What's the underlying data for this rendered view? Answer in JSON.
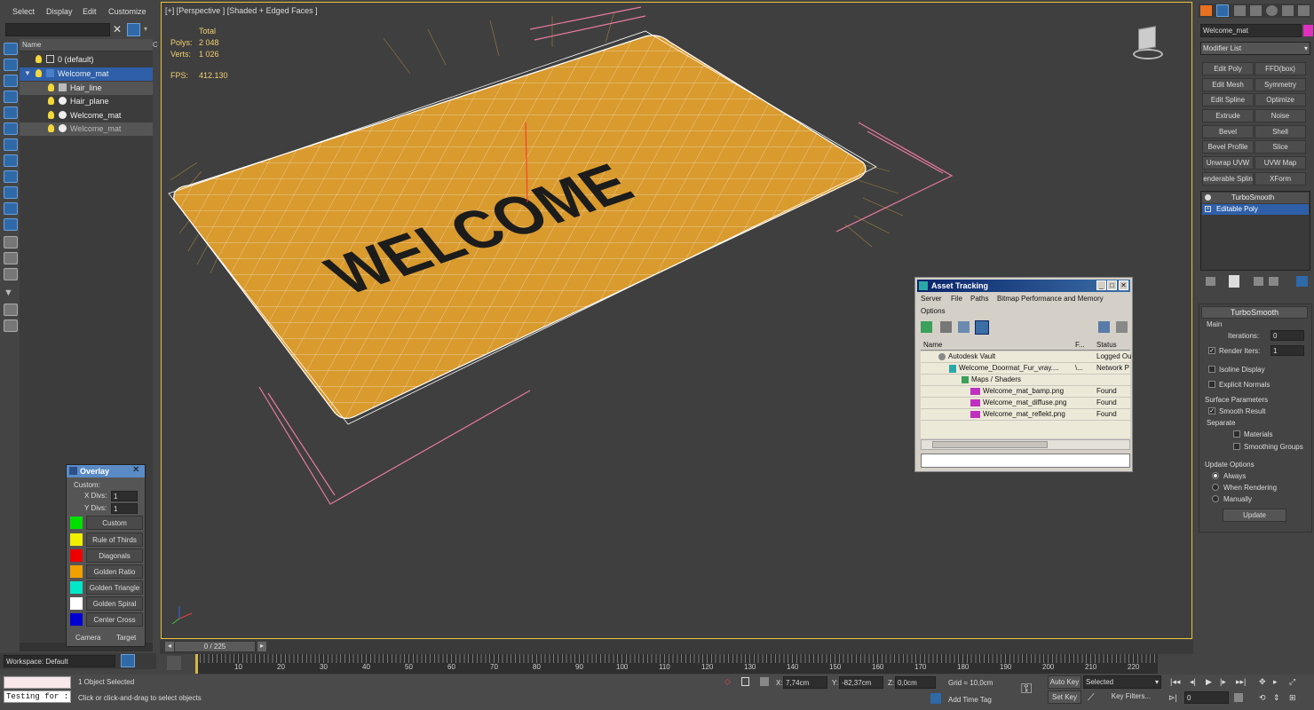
{
  "menu": [
    "Select",
    "Display",
    "Edit",
    "Customize"
  ],
  "explorer": {
    "column_name": "Name",
    "rows": [
      {
        "label": "0 (default)"
      },
      {
        "label": "Welcome_mat"
      },
      {
        "label": "Hair_line"
      },
      {
        "label": "Hair_plane"
      },
      {
        "label": "Welcome_mat"
      },
      {
        "label": "Welcome_mat"
      }
    ],
    "workspace": "Workspace: Default"
  },
  "viewport": {
    "label": "[+] [Perspective ] [Shaded + Edged Faces ]",
    "stats": {
      "total_label": "Total",
      "polys_label": "Polys:",
      "polys_value": "2 048",
      "verts_label": "Verts:",
      "verts_value": "1 026",
      "fps_label": "FPS:",
      "fps_value": "412.130"
    },
    "mat_text": "WELCOME"
  },
  "overlay": {
    "title": "Overlay",
    "custom_label": "Custom:",
    "xdivs_label": "X Divs:",
    "xdivs_value": "1",
    "ydivs_label": "Y Divs:",
    "ydivs_value": "1",
    "items": [
      {
        "label": "Custom",
        "color": "#00e000"
      },
      {
        "label": "Rule of Thirds",
        "color": "#f0f000"
      },
      {
        "label": "Diagonals",
        "color": "#ee0000"
      },
      {
        "label": "Golden Ratio",
        "color": "#f0a000"
      },
      {
        "label": "Golden Triangle",
        "color": "#00e8c8"
      },
      {
        "label": "Golden Spiral",
        "color": "#ffffff"
      },
      {
        "label": "Center Cross",
        "color": "#0000d0"
      }
    ],
    "camera": "Camera",
    "target": "Target"
  },
  "command_panel": {
    "object_name": "Welcome_mat",
    "modifier_list": "Modifier List",
    "modifiers": [
      "Edit Poly",
      "FFD(box)",
      "Edit Mesh",
      "Symmetry",
      "Edit Spline",
      "Optimize",
      "Extrude",
      "Noise",
      "Bevel",
      "Shell",
      "Bevel Profile",
      "Slice",
      "Unwrap UVW",
      "UVW Map",
      "enderable Splin",
      "XForm"
    ],
    "stack": [
      "TurboSmooth",
      "Editable Poly"
    ],
    "turbosmooth": {
      "header": "TurboSmooth",
      "main": "Main",
      "iterations_label": "Iterations:",
      "iterations_value": "0",
      "render_iters_label": "Render Iters:",
      "render_iters_value": "1",
      "isoline": "Isoline Display",
      "explicit_normals": "Explicit Normals",
      "surface_params": "Surface Parameters",
      "smooth_result": "Smooth Result",
      "separate": "Separate",
      "materials": "Materials",
      "smoothing_groups": "Smoothing Groups",
      "update_options": "Update Options",
      "always": "Always",
      "when_rendering": "When Rendering",
      "manually": "Manually",
      "update": "Update"
    }
  },
  "asset_tracking": {
    "title": "Asset Tracking",
    "menu": [
      "Server",
      "File",
      "Paths",
      "Bitmap Performance and Memory"
    ],
    "menu2": "Options",
    "col_name": "Name",
    "col_f": "F...",
    "col_status": "Status",
    "rows": [
      {
        "name": "Autodesk Vault",
        "f": "",
        "status": "Logged Ou"
      },
      {
        "name": "Welcome_Doormat_Fur_vray....",
        "f": "\\...",
        "status": "Network P"
      },
      {
        "name": "Maps / Shaders",
        "f": "",
        "status": ""
      },
      {
        "name": "Welcome_mat_bamp.png",
        "f": "",
        "status": "Found"
      },
      {
        "name": "Welcome_mat_diffuse.png",
        "f": "",
        "status": "Found"
      },
      {
        "name": "Welcome_mat_reflekt.png",
        "f": "",
        "status": "Found"
      }
    ]
  },
  "timeline": {
    "frame": "0 / 225",
    "ticks": [
      "10",
      "20",
      "30",
      "40",
      "50",
      "60",
      "70",
      "80",
      "90",
      "100",
      "110",
      "120",
      "130",
      "140",
      "150",
      "160",
      "170",
      "180",
      "190",
      "200",
      "210",
      "220"
    ]
  },
  "status": {
    "script": "Testing for :",
    "selected": "1 Object Selected",
    "prompt": "Click or click-and-drag to select objects",
    "x_label": "X:",
    "x_value": "7,74cm",
    "y_label": "Y:",
    "y_value": "-82,37cm",
    "z_label": "Z:",
    "z_value": "0,0cm",
    "grid": "Grid = 10,0cm",
    "add_time_tag": "Add Time Tag",
    "auto_key": "Auto Key",
    "set_key": "Set Key",
    "selected_dropdown": "Selected",
    "key_filters": "Key Filters...",
    "frame_value": "0"
  },
  "colors": {
    "accent": "#2e5fa8",
    "viewport_border": "#e8c33a",
    "mat": "#d99a2e"
  }
}
